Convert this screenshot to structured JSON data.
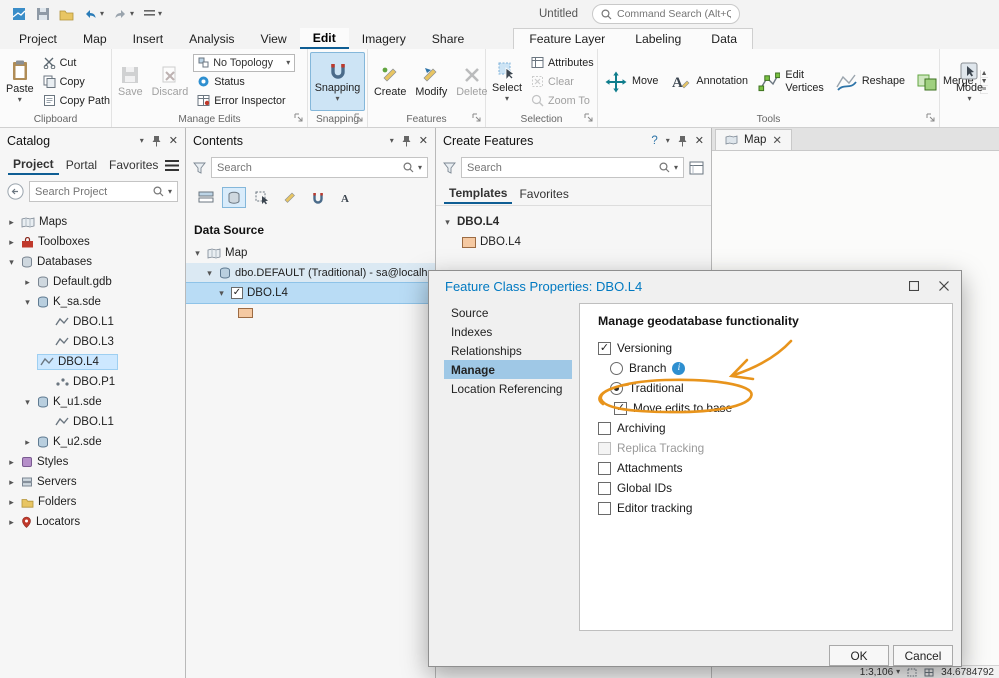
{
  "app": {
    "title": "Untitled",
    "command_search_placeholder": "Command Search (Alt+Q)"
  },
  "ribbon": {
    "tabs": [
      "Project",
      "Map",
      "Insert",
      "Analysis",
      "View",
      "Edit",
      "Imagery",
      "Share"
    ],
    "active_tab": "Edit",
    "contextual_tabs": [
      "Feature Layer",
      "Labeling",
      "Data"
    ],
    "clipboard": {
      "group": "Clipboard",
      "paste": "Paste",
      "cut": "Cut",
      "copy": "Copy",
      "copy_path": "Copy Path"
    },
    "manage_edits": {
      "group": "Manage Edits",
      "save": "Save",
      "discard": "Discard",
      "topology": "No Topology",
      "status": "Status",
      "error_inspector": "Error Inspector"
    },
    "snapping": {
      "group": "Snapping",
      "button": "Snapping"
    },
    "features": {
      "group": "Features",
      "create": "Create",
      "modify": "Modify",
      "delete": "Delete"
    },
    "selection": {
      "group": "Selection",
      "select": "Select",
      "attributes": "Attributes",
      "clear": "Clear",
      "zoom_to": "Zoom To"
    },
    "tools": {
      "group": "Tools",
      "items": [
        "Move",
        "Annotation",
        "Edit Vertices",
        "Reshape",
        "Merge"
      ]
    },
    "mode": {
      "button": "Mode"
    }
  },
  "catalog": {
    "title": "Catalog",
    "tabs": [
      "Project",
      "Portal",
      "Favorites"
    ],
    "search_placeholder": "Search Project",
    "items": [
      "Maps",
      "Toolboxes",
      "Databases",
      "Default.gdb",
      "K_sa.sde",
      "DBO.L1",
      "DBO.L3",
      "DBO.L4",
      "DBO.P1",
      "K_u1.sde",
      "DBO.L1",
      "K_u2.sde",
      "Styles",
      "Servers",
      "Folders",
      "Locators"
    ]
  },
  "contents": {
    "title": "Contents",
    "search_placeholder": "Search",
    "heading": "Data Source",
    "items": [
      "Map",
      "dbo.DEFAULT (Traditional) - sa@localhost:K",
      "DBO.L4"
    ]
  },
  "create_features": {
    "title": "Create Features",
    "search_placeholder": "Search",
    "tabs": [
      "Templates",
      "Favorites"
    ],
    "group": "DBO.L4",
    "template": "DBO.L4"
  },
  "map": {
    "tab": "Map",
    "scale": "1:3,106",
    "coordinates": "34.6784792"
  },
  "dialog": {
    "title": "Feature Class Properties: DBO.L4",
    "nav": [
      "Source",
      "Indexes",
      "Relationships",
      "Manage",
      "Location Referencing"
    ],
    "heading": "Manage geodatabase functionality",
    "options": [
      "Versioning",
      "Branch",
      "Traditional",
      "Move edits to base",
      "Archiving",
      "Replica Tracking",
      "Attachments",
      "Global IDs",
      "Editor tracking"
    ],
    "ok": "OK",
    "cancel": "Cancel"
  },
  "colors": {
    "accent": "#0079c1",
    "annotation": "#e8941c",
    "selection": "#cde8ff"
  }
}
